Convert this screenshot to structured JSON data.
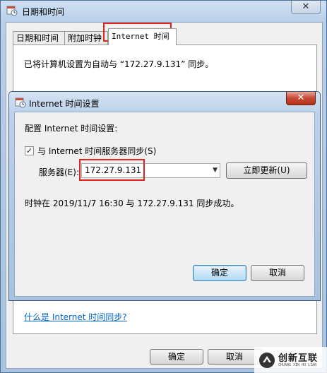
{
  "outer_window": {
    "title": "日期和时间",
    "tabs": [
      {
        "label": "日期和时间"
      },
      {
        "label": "附加时钟"
      },
      {
        "label": "Internet 时间"
      }
    ],
    "status_text": "已将计算机设置为自动与 “172.27.9.131” 同步。",
    "help_link": "什么是 Internet 时间同步?",
    "ok_label": "确定",
    "cancel_label": "取消",
    "close_glyph": "✕"
  },
  "dialog": {
    "title": "Internet 时间设置",
    "config_label": "配置 Internet 时间设置:",
    "sync_checkbox_label": "与 Internet 时间服务器同步(S)",
    "sync_checked": true,
    "server_label": "服务器(E):",
    "server_value": "172.27.9.131",
    "update_label": "立即更新(U)",
    "status": "时钟在 2019/11/7 16:30 与 172.27.9.131 同步成功。",
    "ok_label": "确定",
    "cancel_label": "取消",
    "close_glyph": "✕"
  },
  "watermark": {
    "text": "创新互联",
    "sub": "CHUANG XIN HU LIAN"
  },
  "colors": {
    "highlight": "#e2231a",
    "link": "#0066cc"
  }
}
